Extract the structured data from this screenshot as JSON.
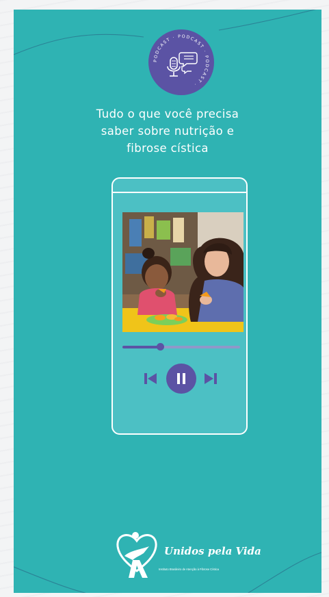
{
  "badge": {
    "ring_text": "PODCAST · PODCAST · PODCAST ·",
    "icon": "microphone-chat-icon",
    "color": "#5b53a4"
  },
  "title": {
    "line1": "Tudo o que você precisa",
    "line2": "saber sobre nutrição e",
    "line3": "fibrose cística"
  },
  "player": {
    "progress_fraction": 0.32,
    "controls": {
      "prev_icon": "skip-previous-icon",
      "pause_icon": "pause-icon",
      "next_icon": "skip-next-icon"
    }
  },
  "brand": {
    "name": "Unidos pela Vida",
    "subtitle": "Instituto Brasileiro de Atenção à Fibrose Cística"
  },
  "colors": {
    "background": "#2fb3b3",
    "phone_screen": "#4cc0c4",
    "accent": "#5b53a4"
  }
}
